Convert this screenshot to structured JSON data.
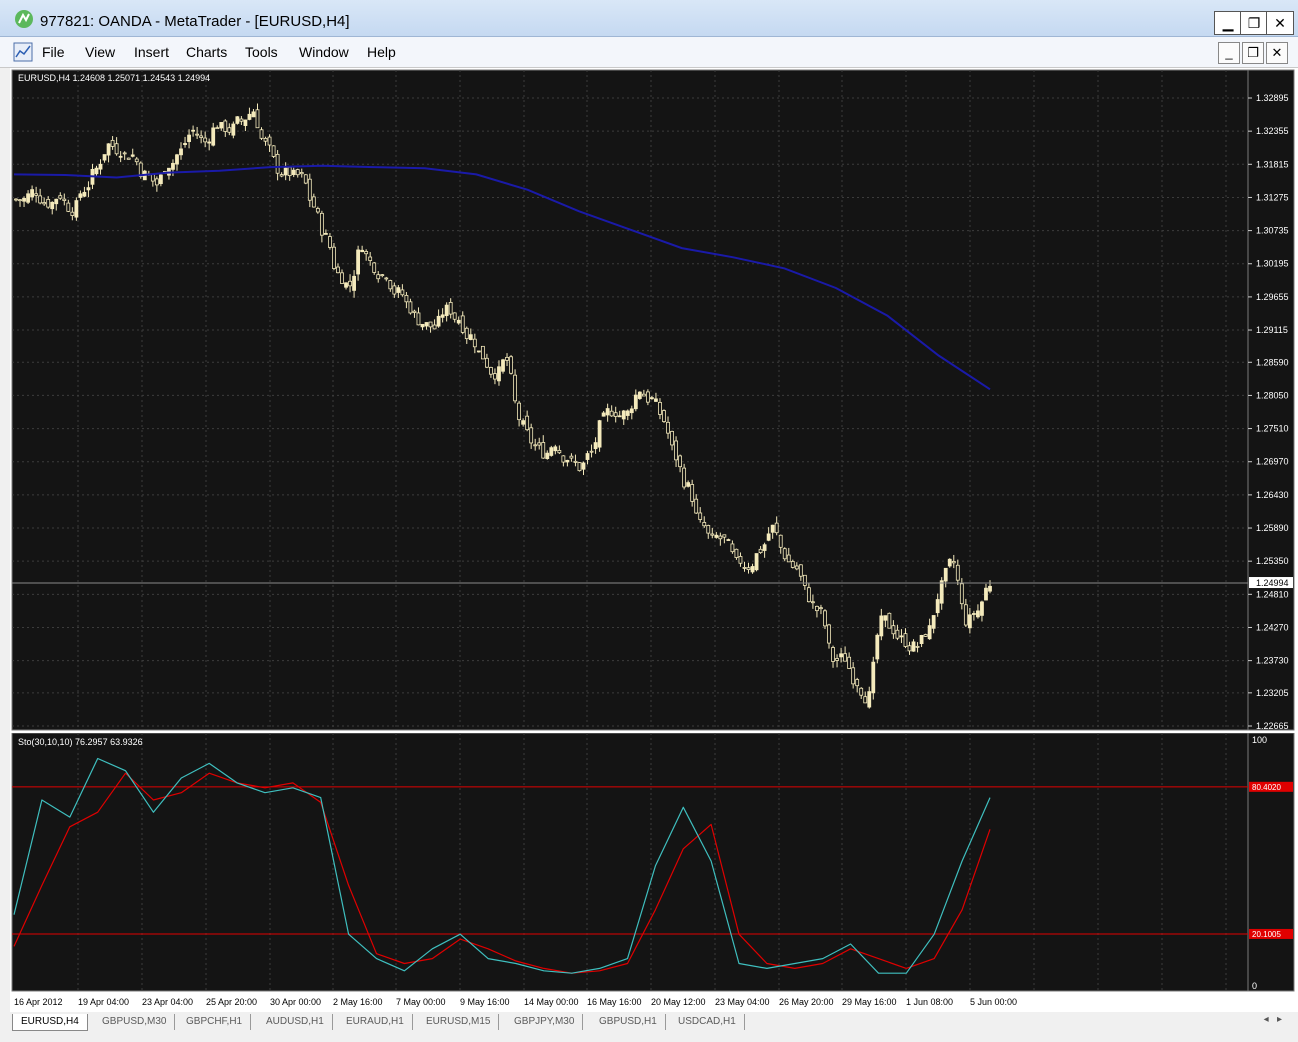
{
  "window": {
    "title": "977821: OANDA - MetaTrader - [EURUSD,H4]"
  },
  "menu": {
    "items": [
      "File",
      "View",
      "Insert",
      "Charts",
      "Tools",
      "Window",
      "Help"
    ]
  },
  "chart": {
    "ohlc_label": "EURUSD,H4  1.24608 1.25071 1.24543 1.24994",
    "price_ticks": [
      "1.32895",
      "1.32355",
      "1.31815",
      "1.31275",
      "1.30735",
      "1.30195",
      "1.29655",
      "1.29115",
      "1.28590",
      "1.28050",
      "1.27510",
      "1.26970",
      "1.26430",
      "1.25890",
      "1.25350",
      "1.24810",
      "1.24270",
      "1.23730",
      "1.23205",
      "1.22665"
    ],
    "current_price": "1.24994",
    "time_ticks": [
      "16 Apr 2012",
      "19 Apr 04:00",
      "23 Apr 04:00",
      "25 Apr 20:00",
      "30 Apr 00:00",
      "2 May 16:00",
      "7 May 00:00",
      "9 May 16:00",
      "14 May 00:00",
      "16 May 16:00",
      "20 May 12:00",
      "23 May 04:00",
      "26 May 20:00",
      "29 May 16:00",
      "1 Jun 08:00",
      "5 Jun 00:00"
    ],
    "colors": {
      "background": "#141414",
      "grid": "#3c3c3c",
      "bull": "#f4eabc",
      "bear": "#f4eabc",
      "ma": "#1a1aa8",
      "sto_main": "#3fbfbf",
      "sto_signal": "#e00000",
      "level": "#e00000"
    }
  },
  "stochastic": {
    "label": "Sto(30,10,10) 76.2957 63.9326",
    "scale_top": "100",
    "scale_bottom": "0",
    "level_high": "80.4020",
    "level_low": "20.1005"
  },
  "chart_data": {
    "type": "candlestick",
    "symbol": "EURUSD",
    "timeframe": "H4",
    "ylim": [
      1.22665,
      1.32895
    ],
    "close_path": [
      1.3124,
      1.3138,
      1.3119,
      1.3132,
      1.3108,
      1.3141,
      1.3174,
      1.3213,
      1.3205,
      1.3196,
      1.3164,
      1.3149,
      1.3182,
      1.3203,
      1.3236,
      1.3218,
      1.3247,
      1.3238,
      1.3252,
      1.3269,
      1.3214,
      1.3175,
      1.3168,
      1.3159,
      1.3113,
      1.3062,
      1.3003,
      1.2985,
      1.3052,
      1.3016,
      1.3004,
      1.2972,
      1.2948,
      1.2923,
      1.2915,
      1.2944,
      1.293,
      1.2901,
      1.2869,
      1.2842,
      1.2862,
      1.2768,
      1.2731,
      1.2713,
      1.2729,
      1.2703,
      1.2688,
      1.2711,
      1.2766,
      1.2779,
      1.2776,
      1.2815,
      1.2798,
      1.2764,
      1.2705,
      1.2655,
      1.2595,
      1.2568,
      1.2569,
      1.2531,
      1.2527,
      1.2554,
      1.2589,
      1.2545,
      1.2523,
      1.2477,
      1.245,
      1.2375,
      1.2378,
      1.2339,
      1.2314,
      1.2435,
      1.2424,
      1.2405,
      1.2398,
      1.2423,
      1.2493,
      1.2532,
      1.2439,
      1.2454,
      1.2499
    ],
    "ma_path": [
      1.3165,
      1.3164,
      1.316,
      1.3168,
      1.3171,
      1.3177,
      1.3179,
      1.3177,
      1.3175,
      1.3165,
      1.314,
      1.3105,
      1.3075,
      1.3045,
      1.303,
      1.3012,
      1.298,
      1.2935,
      1.287,
      1.2815
    ],
    "stochastic_main": [
      28,
      75,
      68,
      92,
      87,
      70,
      84,
      90,
      82,
      78,
      80,
      76,
      20,
      10,
      5,
      14,
      20,
      10,
      8,
      5,
      4,
      6,
      10,
      48,
      72,
      50,
      8,
      6,
      8,
      10,
      16,
      4,
      4,
      20,
      50,
      76
    ],
    "stochastic_signal": [
      15,
      40,
      64,
      70,
      86,
      75,
      78,
      86,
      82,
      80,
      82,
      74,
      40,
      12,
      8,
      10,
      18,
      14,
      9,
      6,
      4,
      5,
      8,
      30,
      55,
      65,
      20,
      8,
      6,
      8,
      14,
      10,
      6,
      10,
      30,
      63
    ],
    "levels": [
      80.402,
      20.1005
    ]
  },
  "tabs": [
    "EURUSD,H4",
    "GBPUSD,M30",
    "GBPCHF,H1",
    "AUDUSD,H1",
    "EURAUD,H1",
    "EURUSD,M15",
    "GBPJPY,M30",
    "GBPUSD,H1",
    "USDCAD,H1"
  ],
  "active_tab": 0
}
